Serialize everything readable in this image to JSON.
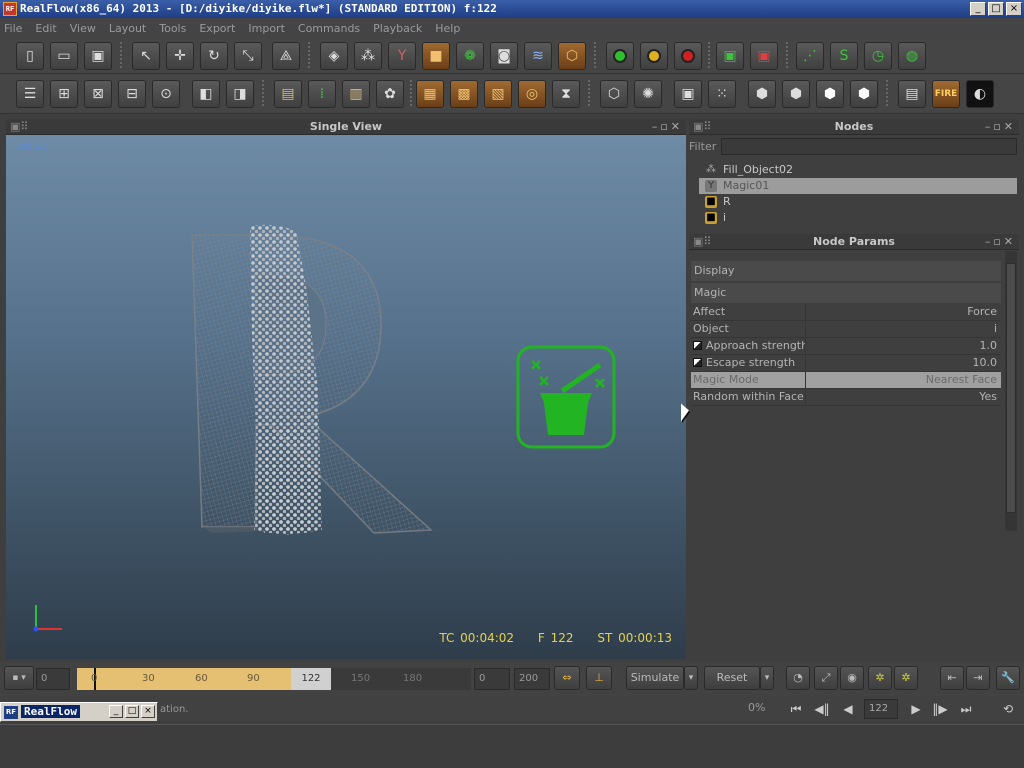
{
  "window": {
    "title": "RealFlow(x86_64) 2013 - [D:/diyike/diyike.flw*] (STANDARD EDITION) f:122",
    "logo": "RF",
    "controls": [
      "_",
      "□",
      "×"
    ]
  },
  "menu": [
    "File",
    "Edit",
    "View",
    "Layout",
    "Tools",
    "Export",
    "Import",
    "Commands",
    "Playback",
    "Help"
  ],
  "toolbar1_icons": [
    "new-file-icon",
    "open-folder-icon",
    "save-icon",
    "select-arrow-icon",
    "move-icon",
    "rotate-icon",
    "scale-icon",
    "axis-icon",
    "box-icon",
    "particles-icon",
    "daemon-icon",
    "cube-icon",
    "mesh-icon",
    "camera-icon",
    "wave-icon",
    "rigid-body-icon",
    "green-circle-icon",
    "yellow-circle-icon",
    "red-circle-icon",
    "export-save-icon",
    "export-red-icon",
    "simulate-icon",
    "reset-icon",
    "timer-icon",
    "network-icon"
  ],
  "toolbar2_icons": [
    "list-icon",
    "daemon-add-icon",
    "daemon-scale-icon",
    "daemon-down-icon",
    "daemon-circle-icon",
    "object-icon",
    "object2-icon",
    "texture-icon",
    "chain-icon",
    "ruler-icon",
    "flower-icon",
    "orange-box-icon",
    "orange-grid-icon",
    "orange-map-icon",
    "orange-target-icon",
    "hourglass-icon",
    "mesh-box-icon",
    "mesh-sphere-icon",
    "mesh-frame-icon",
    "mesh-dots-icon",
    "cube-outline-icon",
    "cube-outline2-icon",
    "cube-white-icon",
    "cube-white2-icon",
    "render-icon",
    "fire-icon",
    "eye-dark-icon"
  ],
  "viewport": {
    "title": "Single View",
    "camera": "persp",
    "hud": {
      "tc": "TC 00:04:02",
      "frame": "F 122",
      "st": "ST 00:00:13"
    }
  },
  "nodes": {
    "title": "Nodes",
    "filter_label": "Filter",
    "filter_value": "",
    "items": [
      {
        "label": "Fill_Object02",
        "icon": "emitter-icon",
        "selected": false
      },
      {
        "label": "Magic01",
        "icon": "daemon-icon",
        "selected": true
      },
      {
        "label": "R",
        "icon": "cube-icon",
        "selected": false
      },
      {
        "label": "i",
        "icon": "cube-icon",
        "selected": false
      }
    ]
  },
  "params": {
    "title": "Node Params",
    "groups": [
      "Display",
      "Magic"
    ],
    "rows": [
      {
        "label": "Affect",
        "value": "Force",
        "check": false,
        "highlight": false
      },
      {
        "label": "Object",
        "value": "i",
        "check": false,
        "highlight": false
      },
      {
        "label": "Approach strength",
        "value": "1.0",
        "check": true,
        "highlight": false
      },
      {
        "label": "Escape strength",
        "value": "10.0",
        "check": true,
        "highlight": false
      },
      {
        "label": "Magic Mode",
        "value": "Nearest Face",
        "check": false,
        "highlight": true
      },
      {
        "label": "Random within Face",
        "value": "Yes",
        "check": false,
        "highlight": false
      }
    ]
  },
  "timeline": {
    "start_box": "0",
    "ticks": [
      "0",
      "30",
      "60",
      "90",
      "150",
      "180"
    ],
    "current": "122",
    "min_field": "0",
    "max_field": "200",
    "simulate_label": "Simulate",
    "reset_label": "Reset"
  },
  "status": {
    "taskbar_title": "RealFlow",
    "message": "ation.",
    "progress": "0%",
    "frame_field": "122"
  },
  "colors": {
    "hud": "#e6d24a",
    "daemon_icon": "#22b422",
    "played_range": "#e5bf72"
  }
}
